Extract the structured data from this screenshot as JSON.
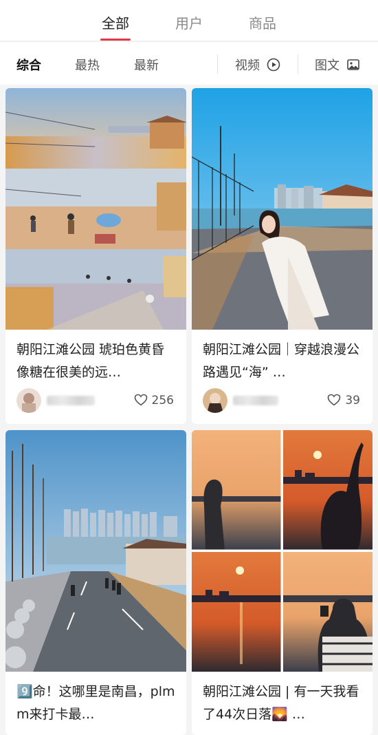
{
  "top_tabs": [
    {
      "label": "全部",
      "active": true
    },
    {
      "label": "用户",
      "active": false
    },
    {
      "label": "商品",
      "active": false
    }
  ],
  "filter": {
    "sort_tabs": [
      {
        "label": "综合",
        "active": true
      },
      {
        "label": "最热",
        "active": false
      },
      {
        "label": "最新",
        "active": false
      }
    ],
    "video_label": "视频",
    "video_icon": "play-circle-icon",
    "image_text_label": "图文",
    "image_text_icon": "image-icon"
  },
  "colors": {
    "accent": "#e1374b"
  },
  "cards": [
    {
      "title": "朝阳江滩公园 琥珀色黄昏像糖在很美的远…",
      "likes": "256",
      "image": "collage of park walkway at golden hour"
    },
    {
      "title": "朝阳江滩公园｜穿越浪漫公路遇见“海” …",
      "likes": "39",
      "image": "woman in white dress on riverside road"
    },
    {
      "title": "9️⃣命！这哪里是南昌，plmm来打卡最…",
      "likes": "",
      "image": "riverside road with high-rise skyline"
    },
    {
      "title": "朝阳江滩公园 | 有一天我看了44次日落🌄 …",
      "likes": "",
      "image": "sunset collage over river"
    }
  ]
}
